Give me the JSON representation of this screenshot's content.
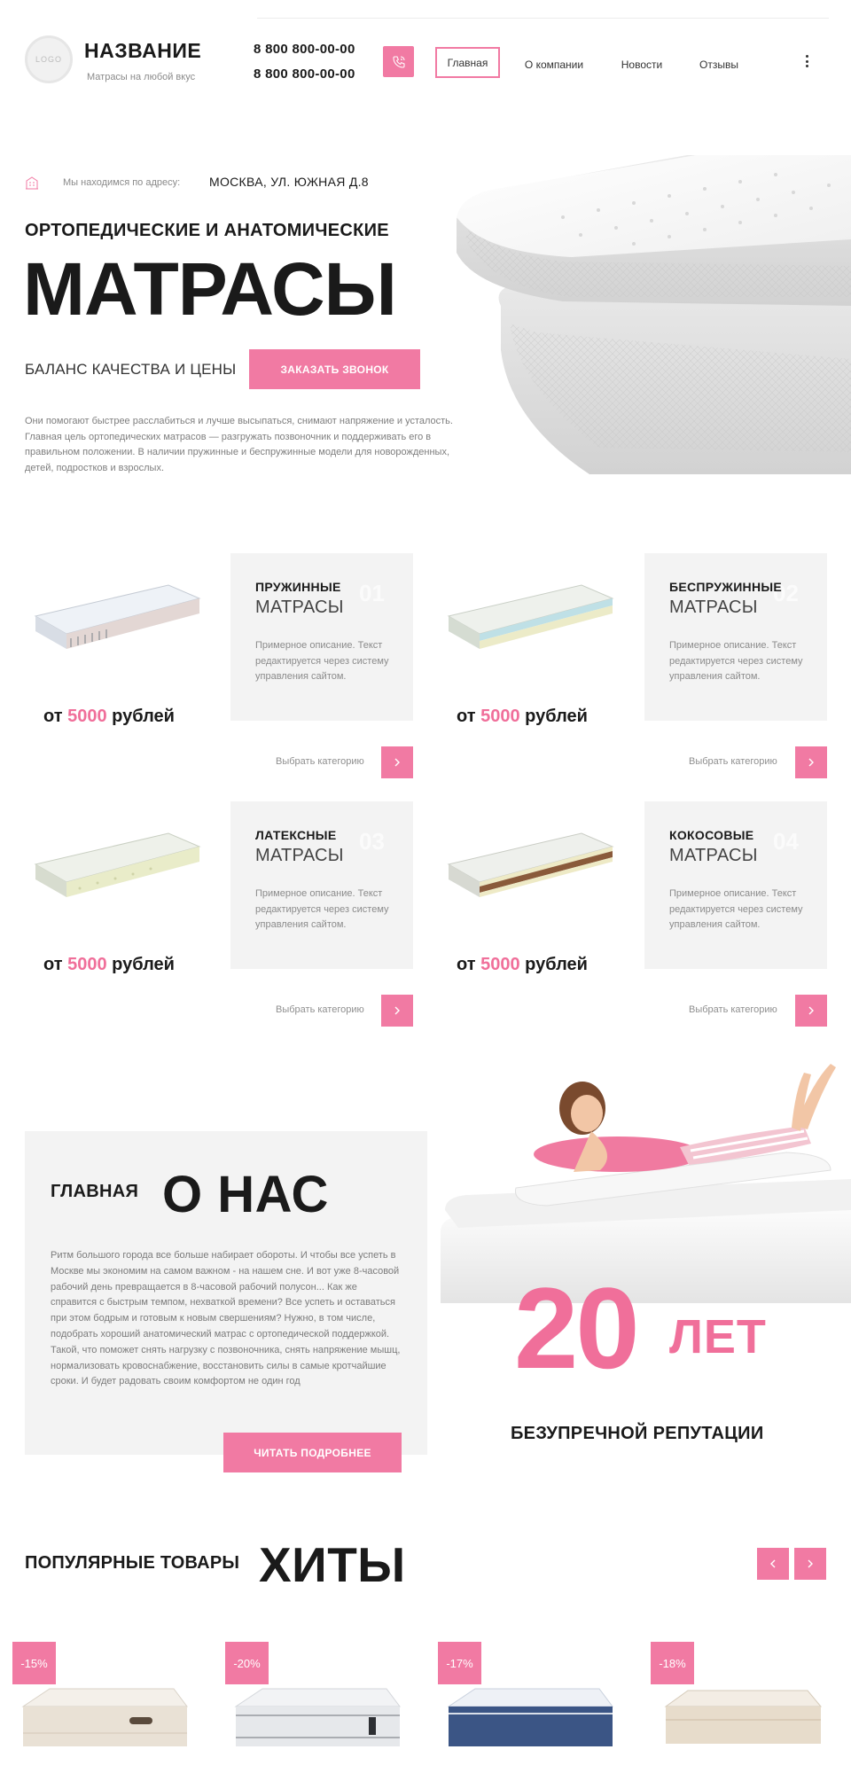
{
  "header": {
    "logo_text": "LOGO",
    "brand": "НАЗВАНИЕ",
    "tagline": "Матрасы на любой вкус",
    "phones": [
      "8 800 800-00-00",
      "8 800 800-00-00"
    ],
    "nav": [
      "Главная",
      "О компании",
      "Новости",
      "Отзывы"
    ],
    "active_nav": "Главная"
  },
  "hero": {
    "address_label": "Мы находимся по адресу:",
    "address_value": "МОСКВА, УЛ. ЮЖНАЯ Д.8",
    "subtitle": "ОРТОПЕДИЧЕСКИЕ И АНАТОМИЧЕСКИЕ",
    "title": "МАТРАСЫ",
    "balance": "БАЛАНС КАЧЕСТВА И ЦЕНЫ",
    "cta": "ЗАКАЗАТЬ ЗВОНОК",
    "description": "Они помогают быстрее расслабиться и лучше высыпаться, снимают напряжение и усталость. Главная цель ортопедических матрасов — разгружать позвоночник и поддерживать его в правильном положении. В наличии пружинные и беспружинные модели для новорожденных, детей, подростков и взрослых."
  },
  "categories": [
    {
      "title": "ПРУЖИННЫЕ",
      "subtitle": "МАТРАСЫ",
      "num": "01",
      "desc": "Примерное описание. Текст редактируется через систему управления сайтом.",
      "price_prefix": "от",
      "price": "5000",
      "price_suffix": "рублей",
      "link": "Выбрать категорию"
    },
    {
      "title": "БЕСПРУЖИННЫЕ",
      "subtitle": "МАТРАСЫ",
      "num": "02",
      "desc": "Примерное описание. Текст редактируется через систему управления сайтом.",
      "price_prefix": "от",
      "price": "5000",
      "price_suffix": "рублей",
      "link": "Выбрать категорию"
    },
    {
      "title": "ЛАТЕКСНЫЕ",
      "subtitle": "МАТРАСЫ",
      "num": "03",
      "desc": "Примерное описание. Текст редактируется через систему управления сайтом.",
      "price_prefix": "от",
      "price": "5000",
      "price_suffix": "рублей",
      "link": "Выбрать категорию"
    },
    {
      "title": "КОКОСОВЫЕ",
      "subtitle": "МАТРАСЫ",
      "num": "04",
      "desc": "Примерное описание. Текст редактируется через систему управления сайтом.",
      "price_prefix": "от",
      "price": "5000",
      "price_suffix": "рублей",
      "link": "Выбрать категорию"
    }
  ],
  "about": {
    "small": "ГЛАВНАЯ",
    "big": "О НАС",
    "text": "Ритм большого города все больше набирает обороты. И чтобы все успеть в Москве мы экономим на самом важном - на нашем сне. И вот уже 8-часовой рабочий день превращается в 8-часовой рабочий полусон... Как же справится с быстрым темпом, нехваткой времени? Все успеть и оставаться при этом бодрым и готовым к новым свершениям? Нужно, в том числе, подобрать хороший анатомический матрас с ортопедической поддержкой. Такой, что поможет снять нагрузку с позвоночника, снять напряжение мышц, нормализовать кровоснабжение, восстановить силы в самые кротчайшие сроки. И будет радовать своим комфортом не один год",
    "button": "ЧИТАТЬ ПОДРОБНЕЕ",
    "years_number": "20",
    "years_word": "ЛЕТ",
    "reputation": "БЕЗУПРЕЧНОЙ РЕПУТАЦИИ"
  },
  "hits": {
    "small": "ПОПУЛЯРНЫЕ ТОВАРЫ",
    "big": "ХИТЫ",
    "discounts": [
      "-15%",
      "-20%",
      "-17%",
      "-18%"
    ]
  },
  "colors": {
    "accent": "#f17aa3",
    "card_bg": "#f3f3f3",
    "text": "#1a1a1a"
  },
  "icons": {
    "phone": "phone-icon",
    "address": "building-icon",
    "arrow": "chevron-right-icon",
    "more": "vertical-dots-icon"
  }
}
